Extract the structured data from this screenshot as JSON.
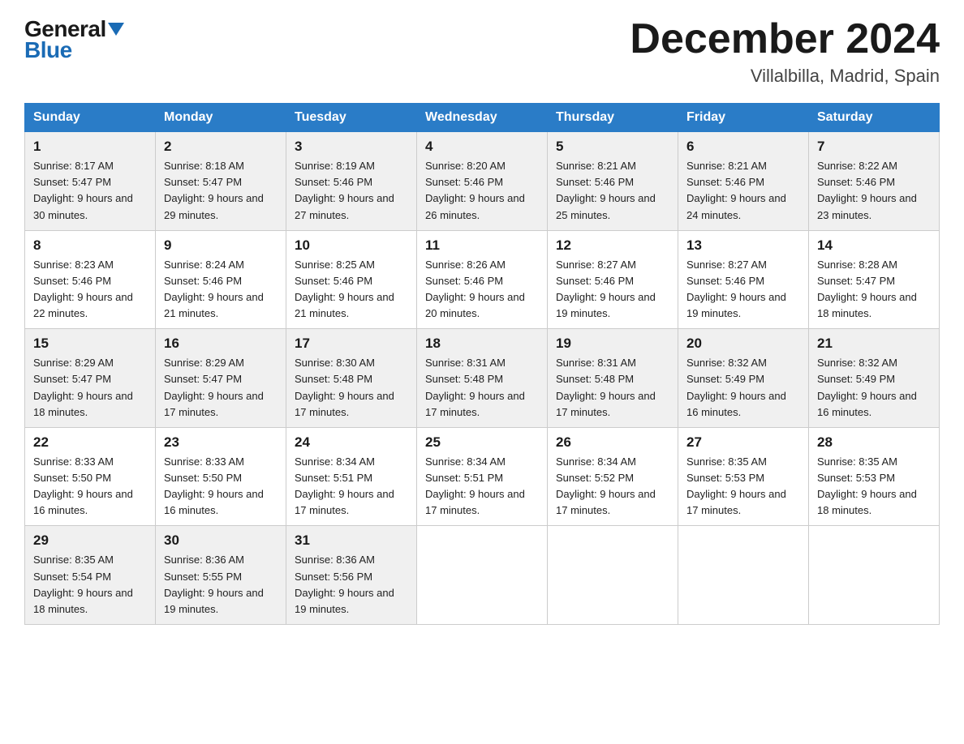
{
  "header": {
    "logo_general": "General",
    "logo_blue": "Blue",
    "month_title": "December 2024",
    "location": "Villalbilla, Madrid, Spain"
  },
  "days_of_week": [
    "Sunday",
    "Monday",
    "Tuesday",
    "Wednesday",
    "Thursday",
    "Friday",
    "Saturday"
  ],
  "weeks": [
    [
      {
        "day": "1",
        "sunrise": "8:17 AM",
        "sunset": "5:47 PM",
        "daylight": "9 hours and 30 minutes."
      },
      {
        "day": "2",
        "sunrise": "8:18 AM",
        "sunset": "5:47 PM",
        "daylight": "9 hours and 29 minutes."
      },
      {
        "day": "3",
        "sunrise": "8:19 AM",
        "sunset": "5:46 PM",
        "daylight": "9 hours and 27 minutes."
      },
      {
        "day": "4",
        "sunrise": "8:20 AM",
        "sunset": "5:46 PM",
        "daylight": "9 hours and 26 minutes."
      },
      {
        "day": "5",
        "sunrise": "8:21 AM",
        "sunset": "5:46 PM",
        "daylight": "9 hours and 25 minutes."
      },
      {
        "day": "6",
        "sunrise": "8:21 AM",
        "sunset": "5:46 PM",
        "daylight": "9 hours and 24 minutes."
      },
      {
        "day": "7",
        "sunrise": "8:22 AM",
        "sunset": "5:46 PM",
        "daylight": "9 hours and 23 minutes."
      }
    ],
    [
      {
        "day": "8",
        "sunrise": "8:23 AM",
        "sunset": "5:46 PM",
        "daylight": "9 hours and 22 minutes."
      },
      {
        "day": "9",
        "sunrise": "8:24 AM",
        "sunset": "5:46 PM",
        "daylight": "9 hours and 21 minutes."
      },
      {
        "day": "10",
        "sunrise": "8:25 AM",
        "sunset": "5:46 PM",
        "daylight": "9 hours and 21 minutes."
      },
      {
        "day": "11",
        "sunrise": "8:26 AM",
        "sunset": "5:46 PM",
        "daylight": "9 hours and 20 minutes."
      },
      {
        "day": "12",
        "sunrise": "8:27 AM",
        "sunset": "5:46 PM",
        "daylight": "9 hours and 19 minutes."
      },
      {
        "day": "13",
        "sunrise": "8:27 AM",
        "sunset": "5:46 PM",
        "daylight": "9 hours and 19 minutes."
      },
      {
        "day": "14",
        "sunrise": "8:28 AM",
        "sunset": "5:47 PM",
        "daylight": "9 hours and 18 minutes."
      }
    ],
    [
      {
        "day": "15",
        "sunrise": "8:29 AM",
        "sunset": "5:47 PM",
        "daylight": "9 hours and 18 minutes."
      },
      {
        "day": "16",
        "sunrise": "8:29 AM",
        "sunset": "5:47 PM",
        "daylight": "9 hours and 17 minutes."
      },
      {
        "day": "17",
        "sunrise": "8:30 AM",
        "sunset": "5:48 PM",
        "daylight": "9 hours and 17 minutes."
      },
      {
        "day": "18",
        "sunrise": "8:31 AM",
        "sunset": "5:48 PM",
        "daylight": "9 hours and 17 minutes."
      },
      {
        "day": "19",
        "sunrise": "8:31 AM",
        "sunset": "5:48 PM",
        "daylight": "9 hours and 17 minutes."
      },
      {
        "day": "20",
        "sunrise": "8:32 AM",
        "sunset": "5:49 PM",
        "daylight": "9 hours and 16 minutes."
      },
      {
        "day": "21",
        "sunrise": "8:32 AM",
        "sunset": "5:49 PM",
        "daylight": "9 hours and 16 minutes."
      }
    ],
    [
      {
        "day": "22",
        "sunrise": "8:33 AM",
        "sunset": "5:50 PM",
        "daylight": "9 hours and 16 minutes."
      },
      {
        "day": "23",
        "sunrise": "8:33 AM",
        "sunset": "5:50 PM",
        "daylight": "9 hours and 16 minutes."
      },
      {
        "day": "24",
        "sunrise": "8:34 AM",
        "sunset": "5:51 PM",
        "daylight": "9 hours and 17 minutes."
      },
      {
        "day": "25",
        "sunrise": "8:34 AM",
        "sunset": "5:51 PM",
        "daylight": "9 hours and 17 minutes."
      },
      {
        "day": "26",
        "sunrise": "8:34 AM",
        "sunset": "5:52 PM",
        "daylight": "9 hours and 17 minutes."
      },
      {
        "day": "27",
        "sunrise": "8:35 AM",
        "sunset": "5:53 PM",
        "daylight": "9 hours and 17 minutes."
      },
      {
        "day": "28",
        "sunrise": "8:35 AM",
        "sunset": "5:53 PM",
        "daylight": "9 hours and 18 minutes."
      }
    ],
    [
      {
        "day": "29",
        "sunrise": "8:35 AM",
        "sunset": "5:54 PM",
        "daylight": "9 hours and 18 minutes."
      },
      {
        "day": "30",
        "sunrise": "8:36 AM",
        "sunset": "5:55 PM",
        "daylight": "9 hours and 19 minutes."
      },
      {
        "day": "31",
        "sunrise": "8:36 AM",
        "sunset": "5:56 PM",
        "daylight": "9 hours and 19 minutes."
      },
      null,
      null,
      null,
      null
    ]
  ],
  "labels": {
    "sunrise_prefix": "Sunrise: ",
    "sunset_prefix": "Sunset: ",
    "daylight_prefix": "Daylight: "
  }
}
